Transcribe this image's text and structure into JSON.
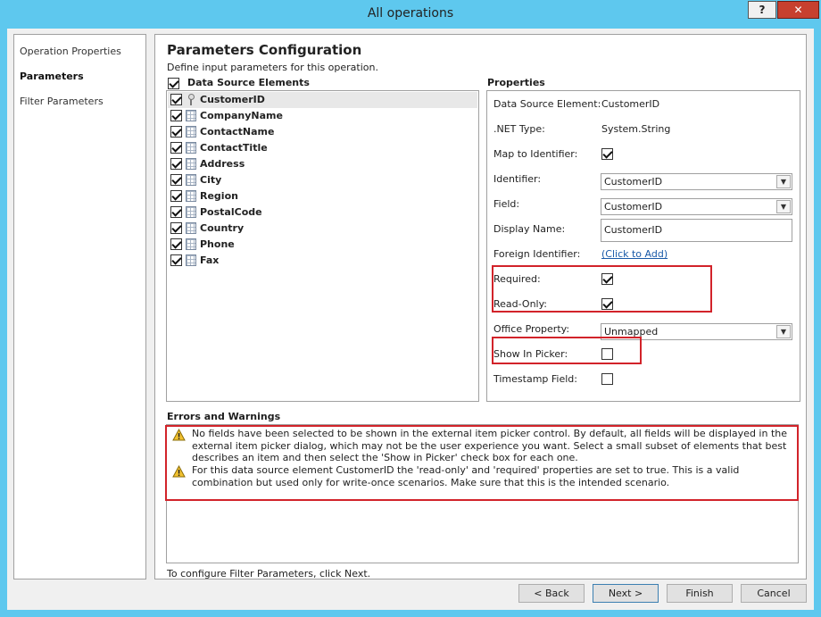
{
  "window": {
    "title": "All operations",
    "help_label": "?",
    "close_label": "✕"
  },
  "nav": {
    "items": [
      {
        "label": "Operation Properties",
        "active": false
      },
      {
        "label": "Parameters",
        "active": true
      },
      {
        "label": "Filter Parameters",
        "active": false
      }
    ]
  },
  "page": {
    "title": "Parameters Configuration",
    "description": "Define input parameters for this operation."
  },
  "data_source": {
    "header_label": "Data Source Elements",
    "header_checked": true,
    "items": [
      {
        "label": "CustomerID",
        "checked": true,
        "icon": "key-icon",
        "selected": true
      },
      {
        "label": "CompanyName",
        "checked": true,
        "icon": "field-icon",
        "selected": false
      },
      {
        "label": "ContactName",
        "checked": true,
        "icon": "field-icon",
        "selected": false
      },
      {
        "label": "ContactTitle",
        "checked": true,
        "icon": "field-icon",
        "selected": false
      },
      {
        "label": "Address",
        "checked": true,
        "icon": "field-icon",
        "selected": false
      },
      {
        "label": "City",
        "checked": true,
        "icon": "field-icon",
        "selected": false
      },
      {
        "label": "Region",
        "checked": true,
        "icon": "field-icon",
        "selected": false
      },
      {
        "label": "PostalCode",
        "checked": true,
        "icon": "field-icon",
        "selected": false
      },
      {
        "label": "Country",
        "checked": true,
        "icon": "field-icon",
        "selected": false
      },
      {
        "label": "Phone",
        "checked": true,
        "icon": "field-icon",
        "selected": false
      },
      {
        "label": "Fax",
        "checked": true,
        "icon": "field-icon",
        "selected": false
      }
    ]
  },
  "properties": {
    "title": "Properties",
    "data_source_element": {
      "label": "Data Source Element:",
      "value": "CustomerID"
    },
    "net_type": {
      "label": ".NET Type:",
      "value": "System.String"
    },
    "map_to_identifier": {
      "label": "Map to Identifier:",
      "checked": true
    },
    "identifier": {
      "label": "Identifier:",
      "value": "CustomerID"
    },
    "field": {
      "label": "Field:",
      "value": "CustomerID"
    },
    "display_name": {
      "label": "Display Name:",
      "value": "CustomerID"
    },
    "foreign_identifier": {
      "label": "Foreign Identifier:",
      "link": "(Click to Add)"
    },
    "required": {
      "label": "Required:",
      "checked": true
    },
    "read_only": {
      "label": "Read-Only:",
      "checked": true
    },
    "office_property": {
      "label": "Office Property:",
      "value": "Unmapped"
    },
    "show_in_picker": {
      "label": "Show In Picker:",
      "checked": false
    },
    "timestamp_field": {
      "label": "Timestamp Field:",
      "checked": false
    }
  },
  "errors": {
    "title": "Errors and Warnings",
    "messages": [
      "No fields have been selected to be shown in the external item picker control. By default, all fields will be displayed in the external item picker dialog, which may not be the user experience you want. Select a small subset of elements that best describes an item and then select the 'Show in Picker' check box for each one.",
      "For this data source element CustomerID the 'read-only' and 'required' properties are set to true. This is a valid combination but used only for write-once scenarios. Make sure that this is the intended scenario."
    ]
  },
  "footer_text": "To configure Filter Parameters, click Next.",
  "buttons": {
    "back": "< Back",
    "next": "Next >",
    "finish": "Finish",
    "cancel": "Cancel"
  },
  "colors": {
    "titlebar": "#5ec8ee",
    "highlight": "#d2232a",
    "link": "#1a5aa8",
    "close_button": "#c7402f"
  }
}
